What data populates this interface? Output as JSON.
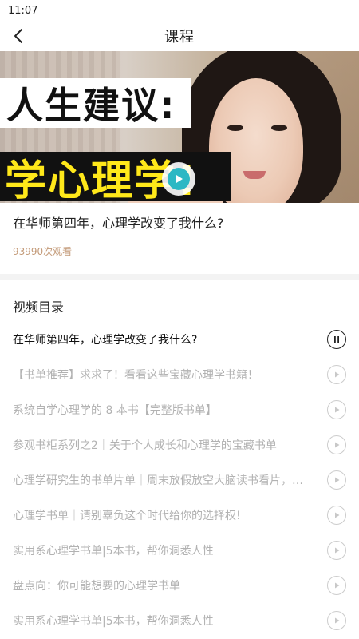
{
  "status_bar": {
    "time": "11:07"
  },
  "header": {
    "title": "课程"
  },
  "video": {
    "banner_top": "人生建议:",
    "banner_bottom": "学心理学!"
  },
  "course": {
    "title": "在华师第四年，心理学改变了我什么?",
    "views": "93990次观看"
  },
  "catalog": {
    "heading": "视频目录",
    "items": [
      {
        "label": "在华师第四年，心理学改变了我什么?",
        "state": "playing"
      },
      {
        "label": "【书单推荐】求求了！看看这些宝藏心理学书籍！",
        "state": "idle"
      },
      {
        "label": "系统自学心理学的 8 本书【完整版书单】",
        "state": "idle"
      },
      {
        "label": "参观书柜系列之2｜关于个人成长和心理学的宝藏书单",
        "state": "idle"
      },
      {
        "label": "心理学研究生的书单片单｜周末放假放空大脑读书看片，一起",
        "state": "idle"
      },
      {
        "label": "心理学书单｜请别辜负这个时代给你的选择权!",
        "state": "idle"
      },
      {
        "label": "实用系心理学书单|5本书，帮你洞悉人性",
        "state": "idle"
      },
      {
        "label": "盘点向：你可能想要的心理学书单",
        "state": "idle"
      },
      {
        "label": "实用系心理学书单|5本书，帮你洞悉人性",
        "state": "idle"
      }
    ]
  },
  "colors": {
    "accent_play": "#2cb8c4",
    "views_text": "#c39a78",
    "inactive_text": "#b2b2b2",
    "banner_yellow": "#ffe81a"
  },
  "icons": {
    "back": "chevron-left-icon",
    "pause": "pause-icon",
    "play": "play-icon"
  }
}
